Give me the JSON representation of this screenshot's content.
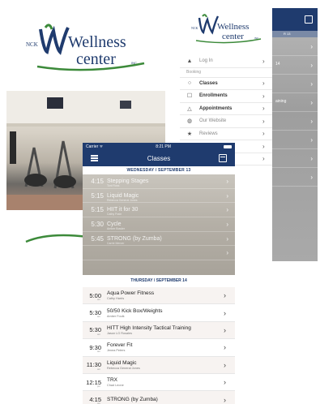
{
  "logo": {
    "prefix": "NCK",
    "wordmark_top": "Wellness",
    "wordmark_bottom": "center",
    "suffix": "INC",
    "colors": {
      "navy": "#1f3b6e",
      "green": "#3c8a3a"
    }
  },
  "menu": {
    "items": [
      {
        "icon": "login-icon",
        "glyph": "▲",
        "label": "Log In",
        "bold": false
      },
      {
        "header": "Booking"
      },
      {
        "icon": "classes-icon",
        "glyph": "○",
        "label": "Classes",
        "bold": true
      },
      {
        "icon": "enrollments-icon",
        "glyph": "☐",
        "label": "Enrollments",
        "bold": true
      },
      {
        "icon": "appointments-icon",
        "glyph": "△",
        "label": "Appointments",
        "bold": true
      },
      {
        "icon": "globe-icon",
        "glyph": "◍",
        "label": "Our Website",
        "bold": false
      },
      {
        "icon": "star-icon",
        "glyph": "★",
        "label": "Reviews",
        "bold": false
      }
    ],
    "background_rows": [
      {
        "text": ""
      },
      {
        "text": "14"
      },
      {
        "text": ""
      },
      {
        "text": "aining"
      },
      {
        "text": ""
      },
      {
        "text": ""
      },
      {
        "text": ""
      },
      {
        "text": ""
      }
    ],
    "date_band": "R 13"
  },
  "phone": {
    "status": {
      "carrier": "Carrier ᯤ",
      "time": "8:21 PM"
    },
    "nav_title": "Classes",
    "day1": {
      "header": "WEDNESDAY / SEPTEMBER 13",
      "rows": [
        {
          "time": "4:15",
          "name": "Stepping Stages",
          "instructor": "Toni Ross"
        },
        {
          "time": "5:15",
          "name": "Liquid Magic",
          "instructor": "Rebecca General Jones"
        },
        {
          "time": "5:15",
          "name": "HIIT it for 30",
          "instructor": "Cathy Frain"
        },
        {
          "time": "5:30",
          "name": "Cycle",
          "instructor": "Amber Bowler"
        },
        {
          "time": "5:45",
          "name": "STRONG (by Zumba)",
          "instructor": "Carrie Mercer"
        },
        {
          "time": "",
          "name": "",
          "instructor": ""
        }
      ]
    },
    "day2": {
      "header": "THURSDAY / SEPTEMBER 14",
      "rows": [
        {
          "time": "5:00",
          "ampm": "am",
          "name": "Aqua Power Fitness",
          "instructor": "Cathy Harris"
        },
        {
          "time": "5:30",
          "ampm": "am",
          "name": "50/50 Kick Box/Weights",
          "instructor": "Amber Foulk"
        },
        {
          "time": "5:30",
          "ampm": "am",
          "name": "HITT High Intensity Tactical Training",
          "instructor": "Jason  LG Rosales"
        },
        {
          "time": "9:30",
          "ampm": "am",
          "name": "Forever Fit",
          "instructor": "Jenea Peters"
        },
        {
          "time": "11:30",
          "ampm": "am",
          "name": "Liquid Magic",
          "instructor": "Rebecca  General Jones"
        },
        {
          "time": "12:15",
          "ampm": "pm",
          "name": "TRX",
          "instructor": "Chad Leone"
        },
        {
          "time": "4:15",
          "ampm": "pm",
          "name": "STRONG (by Zumba)",
          "instructor": ""
        }
      ]
    }
  }
}
